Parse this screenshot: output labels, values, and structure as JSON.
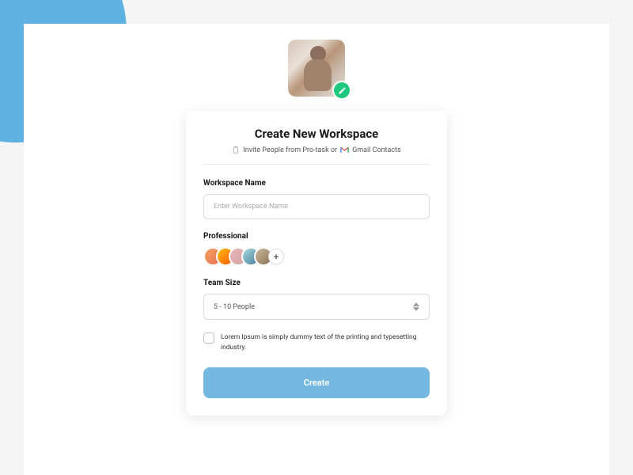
{
  "header": {
    "title": "Create New Workspace",
    "subtitle_prefix": "Invite People from Pro-task or",
    "subtitle_suffix": "Gmail Contacts"
  },
  "form": {
    "workspace_name": {
      "label": "Workspace Name",
      "placeholder": "Enter Workspace Name"
    },
    "professional": {
      "label": "Professional",
      "add_label": "+"
    },
    "team_size": {
      "label": "Team Size",
      "value": "5 - 10 People"
    },
    "consent": {
      "text": "Lorem Ipsum is simply dummy text of the printing and typesetting industry."
    },
    "submit_label": "Create"
  }
}
